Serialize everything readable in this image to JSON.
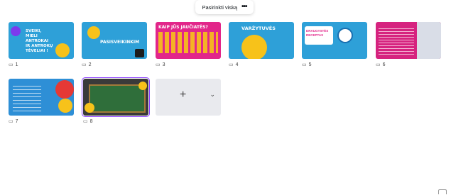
{
  "toolbar": {
    "select_all_label": "Pasirinkti viską",
    "more_label": "•••"
  },
  "pages": [
    {
      "number": "1",
      "text": "SVEIKI, MIELI ANTROKAI IR ANTROKŲ TĖVELIAI !",
      "color": "#2ea0d8"
    },
    {
      "number": "2",
      "text": "PASISVEIKINKIM",
      "color": "#2ea0d8"
    },
    {
      "number": "3",
      "text": "KAIP JŪS JAUČIATĖS?",
      "color": "#e2268a"
    },
    {
      "number": "4",
      "text": "VARŽYTUVĖS",
      "color": "#2ea0d8"
    },
    {
      "number": "5",
      "text": "DRAUGYSTĖS RECEPTAS",
      "color": "#2ea0d8"
    },
    {
      "number": "6",
      "text": "",
      "color": "#d6237f"
    },
    {
      "number": "7",
      "text": "",
      "color": "#2e8fd6"
    },
    {
      "number": "8",
      "text": "",
      "color": "#3a3a3a"
    }
  ],
  "add_page": {
    "plus": "+",
    "chevron": "⌄"
  },
  "comment_icon": "comment-icon"
}
